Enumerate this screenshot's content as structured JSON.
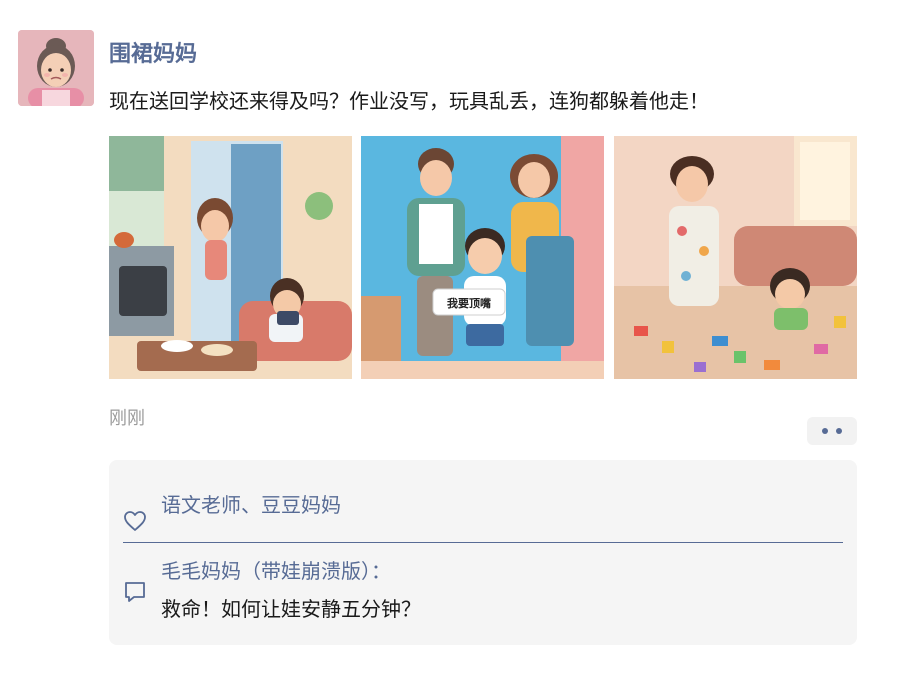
{
  "post": {
    "author": "围裙妈妈",
    "text": "现在送回学校还来得及吗？作业没写，玩具乱丢，连狗都躲着他走！",
    "timestamp": "刚刚",
    "images": [
      {
        "name": "kid-playing-game-on-sofa"
      },
      {
        "name": "parents-scolding-boy",
        "bubble_text": "我要顶嘴"
      },
      {
        "name": "mom-with-toys-mess"
      }
    ]
  },
  "interaction": {
    "likes": "语文老师、豆豆妈妈",
    "comments": [
      {
        "author": "毛毛妈妈（带娃崩溃版）",
        "separator": "：",
        "text": "救命！如何让娃安静五分钟？"
      }
    ]
  },
  "colors": {
    "link_blue": "#576b95",
    "panel_bg": "#f5f5f5",
    "muted_text": "#9b9b9b"
  },
  "icons": [
    "heart-icon",
    "comment-icon",
    "more-dots-icon"
  ]
}
